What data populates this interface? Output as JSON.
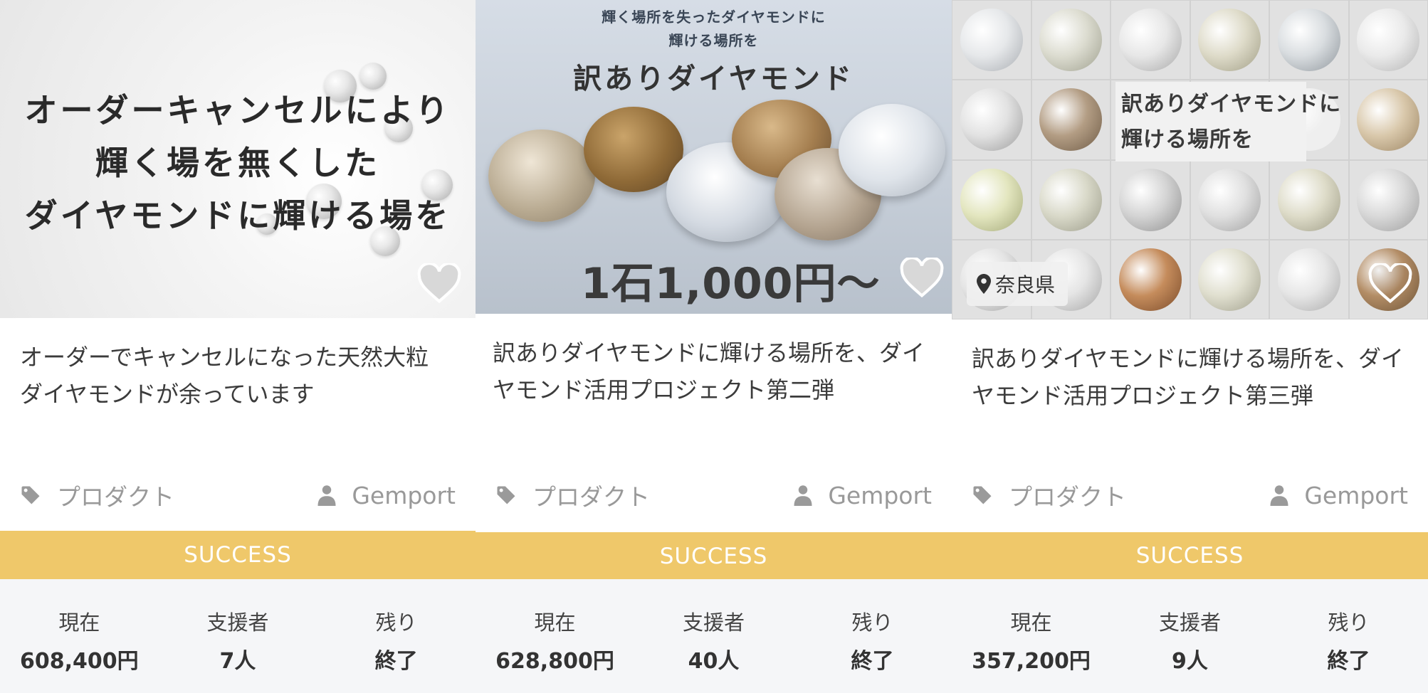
{
  "cards": [
    {
      "image_text_lines": [
        "オーダーキャンセルにより",
        "輝く場を無くした",
        "ダイヤモンドに輝ける場を"
      ],
      "title": "オーダーでキャンセルになった天然大粒ダイヤモンドが余っています",
      "category": "プロダクト",
      "owner": "Gemport",
      "status": "SUCCESS",
      "stats": [
        {
          "label": "現在",
          "value": "608,400円"
        },
        {
          "label": "支援者",
          "value": "7人"
        },
        {
          "label": "残り",
          "value": "終了"
        }
      ]
    },
    {
      "image_top1": "輝く場所を失ったダイヤモンドに",
      "image_top2": "輝ける場所を",
      "image_title": "訳ありダイヤモンド",
      "image_price": "1石1,000円〜",
      "title": "訳ありダイヤモンドに輝ける場所を、ダイヤモンド活用プロジェクト第二弾",
      "category": "プロダクト",
      "owner": "Gemport",
      "status": "SUCCESS",
      "stats": [
        {
          "label": "現在",
          "value": "628,800円"
        },
        {
          "label": "支援者",
          "value": "40人"
        },
        {
          "label": "残り",
          "value": "終了"
        }
      ]
    },
    {
      "image_banner_line1": "訳ありダイヤモンドに",
      "image_banner_line2": "輝ける場所を",
      "location": "奈良県",
      "title": "訳ありダイヤモンドに輝ける場所を、ダイヤモンド活用プロジェクト第三弾",
      "category": "プロダクト",
      "owner": "Gemport",
      "status": "SUCCESS",
      "stats": [
        {
          "label": "現在",
          "value": "357,200円"
        },
        {
          "label": "支援者",
          "value": "9人"
        },
        {
          "label": "残り",
          "value": "終了"
        }
      ]
    }
  ],
  "colors": {
    "success_bar": "#efc86a",
    "stats_bg": "#f5f6f8",
    "meta_text": "#999999"
  },
  "icons": {
    "category": "tag-icon",
    "owner": "user-icon",
    "favorite": "heart-icon",
    "location": "map-pin-icon"
  }
}
